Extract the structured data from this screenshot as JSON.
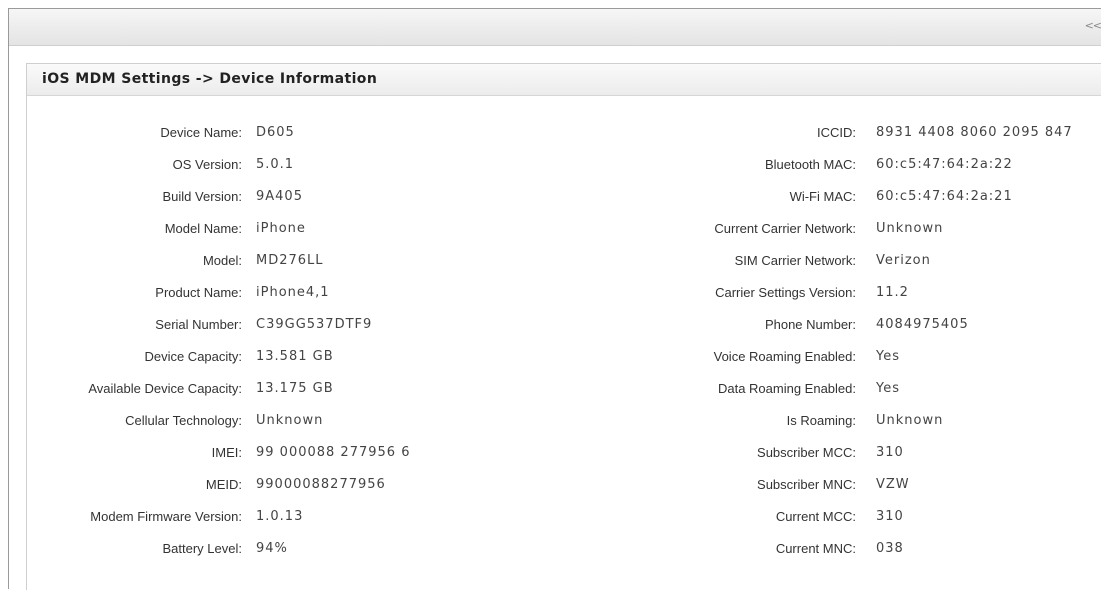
{
  "toolbar": {
    "collapse_label": "<<"
  },
  "panel": {
    "title": "iOS MDM Settings -> Device Information"
  },
  "left_fields": [
    {
      "label": "Device Name:",
      "value": "D605"
    },
    {
      "label": "OS Version:",
      "value": "5.0.1"
    },
    {
      "label": "Build Version:",
      "value": "9A405"
    },
    {
      "label": "Model Name:",
      "value": "iPhone"
    },
    {
      "label": "Model:",
      "value": "MD276LL"
    },
    {
      "label": "Product Name:",
      "value": "iPhone4,1"
    },
    {
      "label": "Serial Number:",
      "value": "C39GG537DTF9"
    },
    {
      "label": "Device Capacity:",
      "value": "13.581 GB"
    },
    {
      "label": "Available Device Capacity:",
      "value": "13.175 GB"
    },
    {
      "label": "Cellular Technology:",
      "value": "Unknown"
    },
    {
      "label": "IMEI:",
      "value": "99 000088 277956 6"
    },
    {
      "label": "MEID:",
      "value": "99000088277956"
    },
    {
      "label": "Modem Firmware Version:",
      "value": "1.0.13"
    },
    {
      "label": "Battery Level:",
      "value": "94%"
    }
  ],
  "right_fields": [
    {
      "label": "ICCID:",
      "value": "8931 4408 8060 2095 847"
    },
    {
      "label": "Bluetooth MAC:",
      "value": "60:c5:47:64:2a:22"
    },
    {
      "label": "Wi-Fi MAC:",
      "value": "60:c5:47:64:2a:21"
    },
    {
      "label": "Current Carrier Network:",
      "value": "Unknown"
    },
    {
      "label": "SIM Carrier Network:",
      "value": "Verizon"
    },
    {
      "label": "Carrier Settings Version:",
      "value": "11.2"
    },
    {
      "label": "Phone Number:",
      "value": "4084975405"
    },
    {
      "label": "Voice Roaming Enabled:",
      "value": "Yes"
    },
    {
      "label": "Data Roaming Enabled:",
      "value": "Yes"
    },
    {
      "label": "Is Roaming:",
      "value": "Unknown"
    },
    {
      "label": "Subscriber MCC:",
      "value": "310"
    },
    {
      "label": "Subscriber MNC:",
      "value": "VZW"
    },
    {
      "label": "Current MCC:",
      "value": "310"
    },
    {
      "label": "Current MNC:",
      "value": "038"
    }
  ]
}
